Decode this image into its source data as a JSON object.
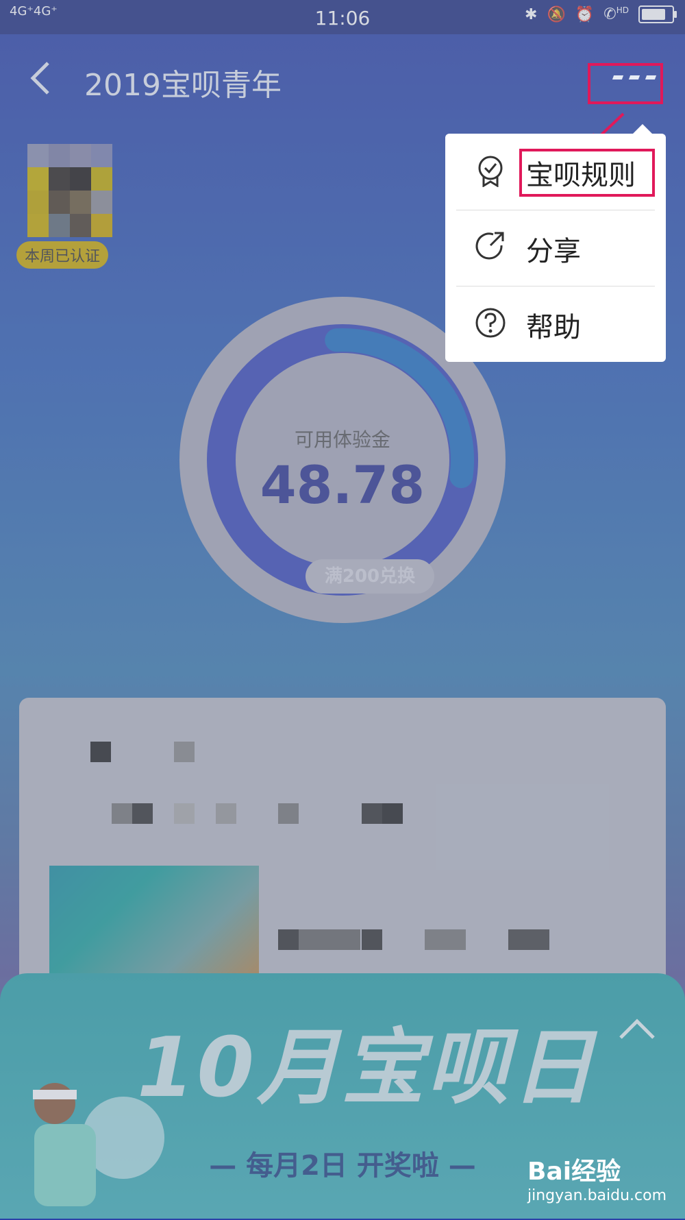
{
  "status_bar": {
    "network": "4G⁺4G⁺",
    "time": "11:06",
    "hd": "HD"
  },
  "header": {
    "title": "2019宝呗青年"
  },
  "profile": {
    "badge": "本周已认证"
  },
  "balance": {
    "label": "可用体验金",
    "value": "48.78",
    "exchange_label": "满200兑换",
    "progress": 0.28
  },
  "menu": {
    "items": [
      {
        "label": "宝呗规则",
        "icon": "badge-check-icon"
      },
      {
        "label": "分享",
        "icon": "share-icon"
      },
      {
        "label": "帮助",
        "icon": "help-icon"
      }
    ]
  },
  "banner": {
    "title": "10月宝呗日",
    "subtitle": "— 每月2日 开奖啦 —"
  },
  "watermark": {
    "brand": "Bai经验",
    "url": "jingyan.baidu.com"
  },
  "colors": {
    "highlight": "#e0195a",
    "accent_blue": "#2b3490"
  }
}
